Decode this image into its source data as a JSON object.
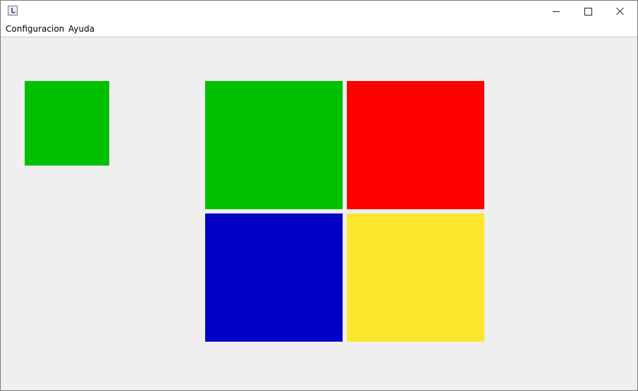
{
  "menu": {
    "items": [
      "Configuracion",
      "Ayuda"
    ]
  },
  "colors": {
    "sample": "#00c000",
    "tiles": {
      "green": "#00c000",
      "red": "#ff0000",
      "blue": "#0000c6",
      "yellow": "#fde52e"
    }
  },
  "icons": {
    "app": "java-cup-icon",
    "minimize": "minimize-icon",
    "maximize": "maximize-icon",
    "close": "close-icon"
  }
}
